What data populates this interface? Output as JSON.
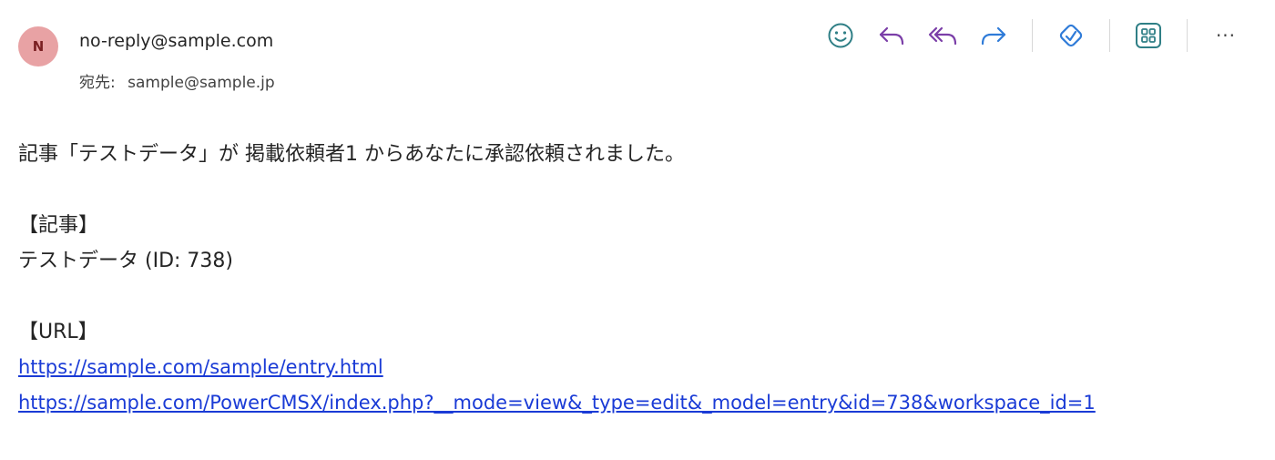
{
  "header": {
    "avatar_initial": "N",
    "sender": "no-reply@sample.com",
    "to_label": "宛先:",
    "recipient": "sample@sample.jp"
  },
  "toolbar": {
    "icons": [
      "emoji-icon",
      "reply-icon",
      "reply-all-icon",
      "forward-icon",
      "tag-icon",
      "apps-icon",
      "more-icon"
    ],
    "more_label": "···",
    "colors": {
      "teal": "#2f7f86",
      "purple": "#7b3fa8",
      "blue": "#2f7bd8"
    }
  },
  "body": {
    "intro": "記事「テストデータ」が 掲載依頼者1 からあなたに承認依頼されました。",
    "article_heading": "【記事】",
    "article_line": "テストデータ (ID: 738)",
    "url_heading": "【URL】",
    "link_1": "https://sample.com/sample/entry.html",
    "link_2": "https://sample.com/PowerCMSX/index.php?__mode=view&_type=edit&_model=entry&id=738&workspace_id=1"
  }
}
